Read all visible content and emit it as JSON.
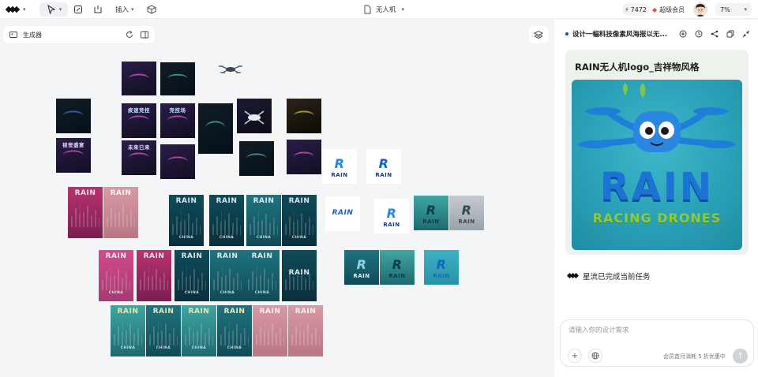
{
  "topbar": {
    "insert_label": "插入",
    "doc_title": "无人机",
    "credits": "7472",
    "vip_label": "超级会员",
    "zoom": "7%"
  },
  "canvas": {
    "generator_label": "生成器",
    "poster_words": {
      "rain": "RAIN",
      "china": "CHINA",
      "tag1": "疾速竞技",
      "tag2": "视觉盛宴",
      "tag3": "未来已来",
      "tag4": "竞技场"
    },
    "logo_words": {
      "r": "R",
      "rain": "RAIN"
    }
  },
  "chat": {
    "title": "设计一幅科技像素风海报以无...",
    "card_title": "RAIN无人机logo_吉祥物风格",
    "card_image": {
      "main_text": "RAIN",
      "sub_text": "RACING DRONES"
    },
    "done_message": "星流已完成当前任务",
    "input_placeholder": "请输入你的设计需求",
    "input_value": "",
    "hint": "会员首月消耗 5 折优惠中"
  },
  "colors": {
    "accent_blue": "#1b73d4",
    "accent_green": "#8ccc3e",
    "vip_red": "#e8503a"
  },
  "icons": {
    "logo": "diamond-logo-icon",
    "select": "cursor-icon",
    "edit": "edit-icon",
    "frame": "frame-icon",
    "cube": "cube-icon",
    "doc": "document-icon",
    "lightning": "lightning-icon",
    "layers": "layers-icon"
  }
}
